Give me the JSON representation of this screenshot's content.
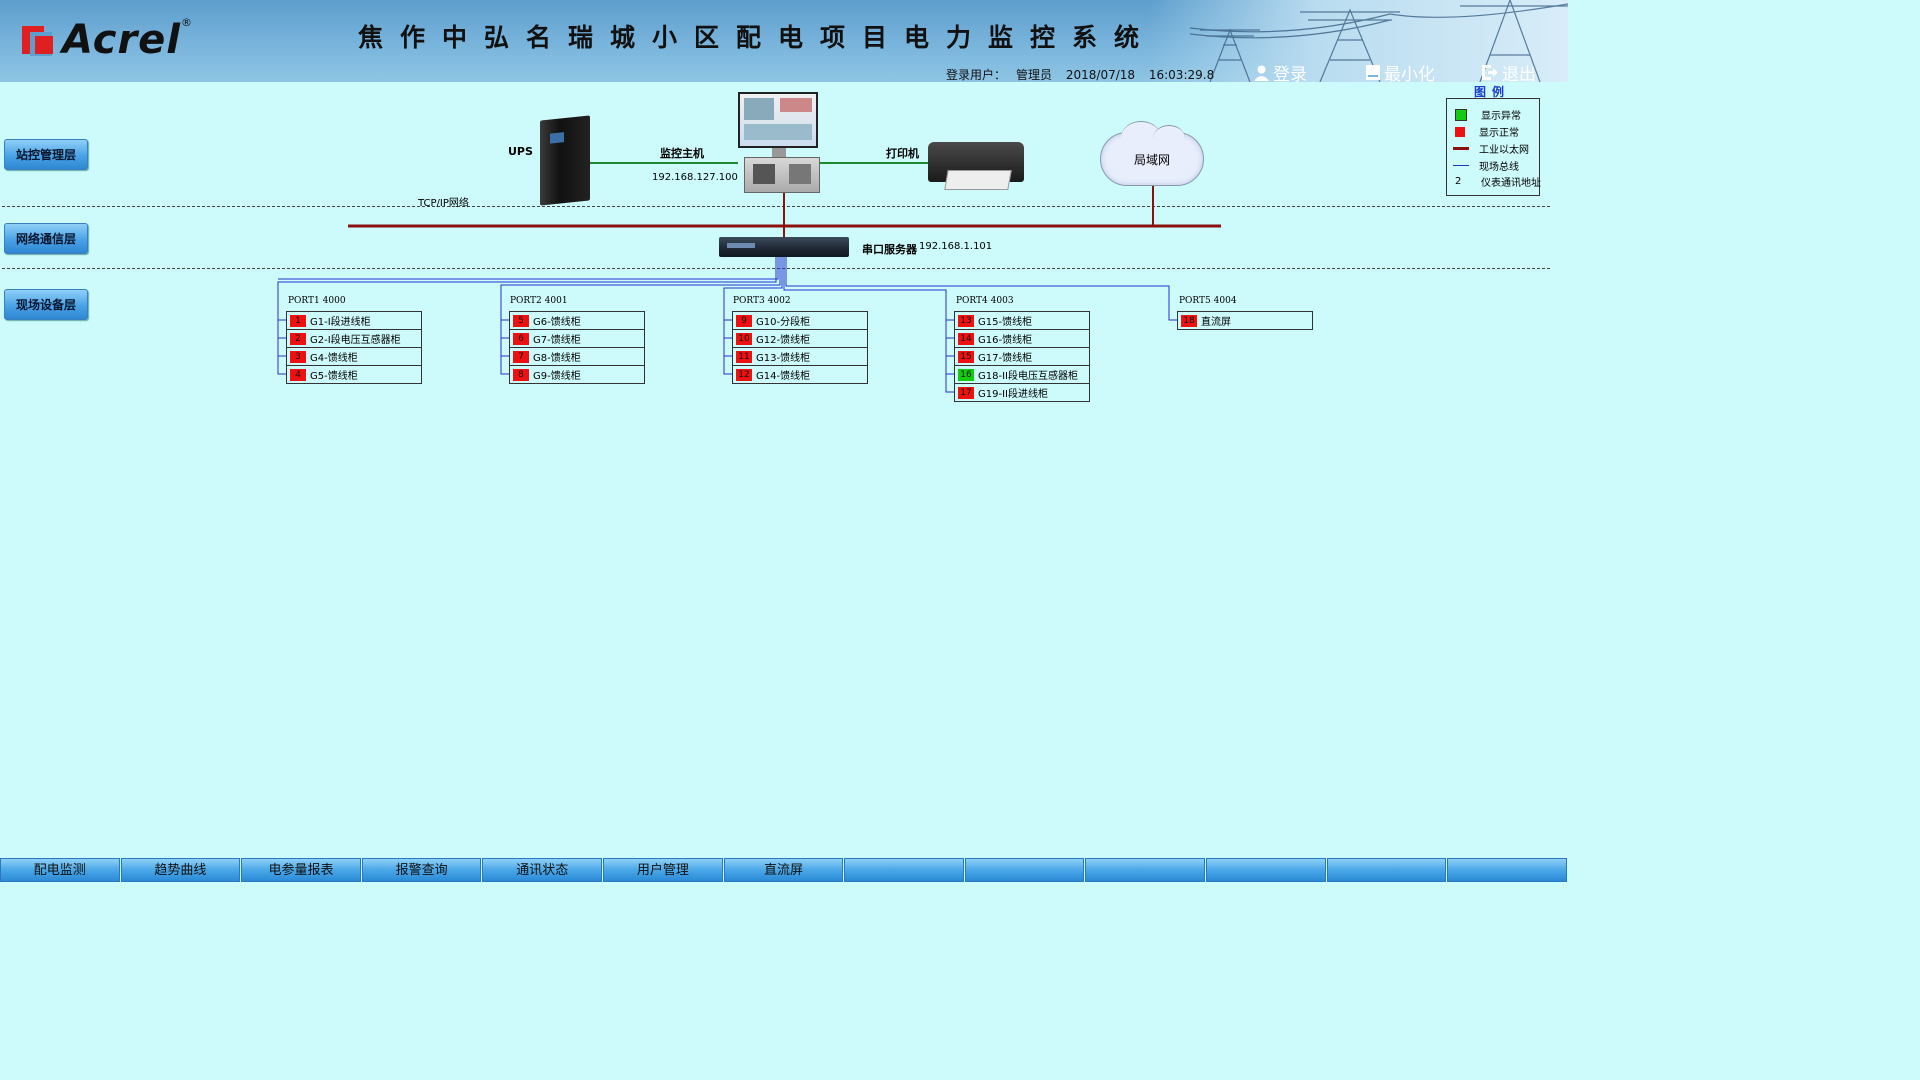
{
  "header": {
    "logo_text": "Acrel",
    "title": "焦作中弘名瑞城小区配电项目电力监控系统",
    "user_label": "登录用户：",
    "user_name": "管理员",
    "date": "2018/07/18",
    "time": "16:03:29.8",
    "buttons": {
      "login": "登录",
      "minimize": "最小化",
      "logout": "退出"
    }
  },
  "layers": [
    "站控管理层",
    "网络通信层",
    "现场设备层"
  ],
  "devices": {
    "ups": "UPS",
    "host": "监控主机",
    "host_ip": "192.168.127.100",
    "printer": "打印机",
    "lan": "局域网",
    "tcpip": "TCP/IP网络",
    "serial_server": "串口服务器",
    "serial_ip": "192.168.1.101"
  },
  "ports": [
    {
      "label": "PORT1  4000",
      "items": [
        {
          "addr": "1",
          "name": "G1-I段进线柜",
          "status": "red"
        },
        {
          "addr": "2",
          "name": "G2-I段电压互感器柜",
          "status": "red"
        },
        {
          "addr": "3",
          "name": "G4-馈线柜",
          "status": "red"
        },
        {
          "addr": "4",
          "name": "G5-馈线柜",
          "status": "red"
        }
      ]
    },
    {
      "label": "PORT2  4001",
      "items": [
        {
          "addr": "5",
          "name": "G6-馈线柜",
          "status": "red"
        },
        {
          "addr": "6",
          "name": "G7-馈线柜",
          "status": "red"
        },
        {
          "addr": "7",
          "name": "G8-馈线柜",
          "status": "red"
        },
        {
          "addr": "8",
          "name": "G9-馈线柜",
          "status": "red"
        }
      ]
    },
    {
      "label": "PORT3  4002",
      "items": [
        {
          "addr": "9",
          "name": "G10-分段柜",
          "status": "red"
        },
        {
          "addr": "10",
          "name": "G12-馈线柜",
          "status": "red"
        },
        {
          "addr": "11",
          "name": "G13-馈线柜",
          "status": "red"
        },
        {
          "addr": "12",
          "name": "G14-馈线柜",
          "status": "red"
        }
      ]
    },
    {
      "label": "PORT4  4003",
      "items": [
        {
          "addr": "13",
          "name": "G15-馈线柜",
          "status": "red"
        },
        {
          "addr": "14",
          "name": "G16-馈线柜",
          "status": "red"
        },
        {
          "addr": "15",
          "name": "G17-馈线柜",
          "status": "red"
        },
        {
          "addr": "16",
          "name": "G18-II段电压互感器柜",
          "status": "green"
        },
        {
          "addr": "17",
          "name": "G19-II段进线柜",
          "status": "red"
        }
      ]
    },
    {
      "label": "PORT5  4004",
      "items": [
        {
          "addr": "18",
          "name": "直流屏",
          "status": "red"
        }
      ]
    }
  ],
  "legend": {
    "title": "图例",
    "items": [
      {
        "label": "显示异常",
        "kind": "swatch",
        "color": "#11cc11"
      },
      {
        "label": "显示正常",
        "kind": "swatch",
        "color": "#ee1111"
      },
      {
        "label": "工业以太网",
        "kind": "line",
        "color": "#8b1010"
      },
      {
        "label": "现场总线",
        "kind": "line",
        "color": "#2233cc"
      },
      {
        "label": "仪表通讯地址",
        "kind": "text",
        "symbol": "2"
      }
    ]
  },
  "colors": {
    "red": "#ee1111",
    "green": "#11cc11",
    "ethernet": "#8b1010",
    "bus": "#2233cc",
    "link": "#1a8a2a"
  },
  "bottom_tabs": [
    "配电监测",
    "趋势曲线",
    "电参量报表",
    "报警查询",
    "通讯状态",
    "用户管理",
    "直流屏",
    "",
    "",
    "",
    "",
    "",
    ""
  ]
}
